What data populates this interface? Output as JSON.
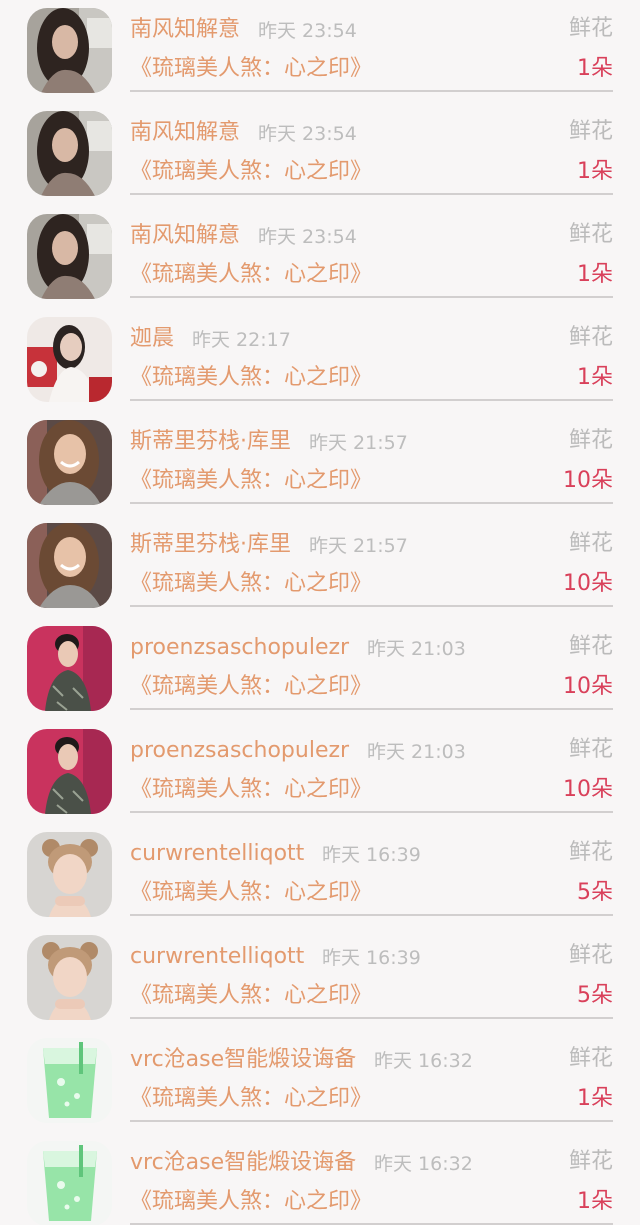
{
  "gift_list": [
    {
      "avatar": "woman-long-dark-hair-photo",
      "name": "南风知解意",
      "time": "昨天 23:54",
      "gift_type": "鲜花",
      "book": "《琉璃美人煞：心之印》",
      "count": "1朵"
    },
    {
      "avatar": "woman-long-dark-hair-photo",
      "name": "南风知解意",
      "time": "昨天 23:54",
      "gift_type": "鲜花",
      "book": "《琉璃美人煞：心之印》",
      "count": "1朵"
    },
    {
      "avatar": "woman-long-dark-hair-photo",
      "name": "南风知解意",
      "time": "昨天 23:54",
      "gift_type": "鲜花",
      "book": "《琉璃美人煞：心之印》",
      "count": "1朵"
    },
    {
      "avatar": "woman-white-red-photo",
      "name": "迦晨",
      "time": "昨天 22:17",
      "gift_type": "鲜花",
      "book": "《琉璃美人煞：心之印》",
      "count": "1朵"
    },
    {
      "avatar": "smiling-woman-photo",
      "name": "斯蒂里芬栈·库里",
      "time": "昨天 21:57",
      "gift_type": "鲜花",
      "book": "《琉璃美人煞：心之印》",
      "count": "10朵"
    },
    {
      "avatar": "smiling-woman-photo",
      "name": "斯蒂里芬栈·库里",
      "time": "昨天 21:57",
      "gift_type": "鲜花",
      "book": "《琉璃美人煞：心之印》",
      "count": "10朵"
    },
    {
      "avatar": "woman-qipao-pink-background-photo",
      "name": "proenzsaschopulezr",
      "time": "昨天 21:03",
      "gift_type": "鲜花",
      "book": "《琉璃美人煞：心之印》",
      "count": "10朵"
    },
    {
      "avatar": "woman-qipao-pink-background-photo",
      "name": "proenzsaschopulezr",
      "time": "昨天 21:03",
      "gift_type": "鲜花",
      "book": "《琉璃美人煞：心之印》",
      "count": "10朵"
    },
    {
      "avatar": "child-portrait-photo",
      "name": "curwrentelliqott",
      "time": "昨天 16:39",
      "gift_type": "鲜花",
      "book": "《琉璃美人煞：心之印》",
      "count": "5朵"
    },
    {
      "avatar": "child-portrait-photo",
      "name": "curwrentelliqott",
      "time": "昨天 16:39",
      "gift_type": "鲜花",
      "book": "《琉璃美人煞：心之印》",
      "count": "5朵"
    },
    {
      "avatar": "green-drink-glass-photo",
      "name": "vrc沧ase智能煅设诲备",
      "time": "昨天 16:32",
      "gift_type": "鲜花",
      "book": "《琉璃美人煞：心之印》",
      "count": "1朵"
    },
    {
      "avatar": "green-drink-glass-photo",
      "name": "vrc沧ase智能煅设诲备",
      "time": "昨天 16:32",
      "gift_type": "鲜花",
      "book": "《琉璃美人煞：心之印》",
      "count": "1朵"
    }
  ],
  "colors": {
    "name": "#e39a6e",
    "book_title": "#e39a6e",
    "time": "#bdbdbd",
    "gift_type": "#bbbbbb",
    "count": "#d9405a",
    "divider": "#d2cfcf",
    "background": "#f8f6f6"
  }
}
